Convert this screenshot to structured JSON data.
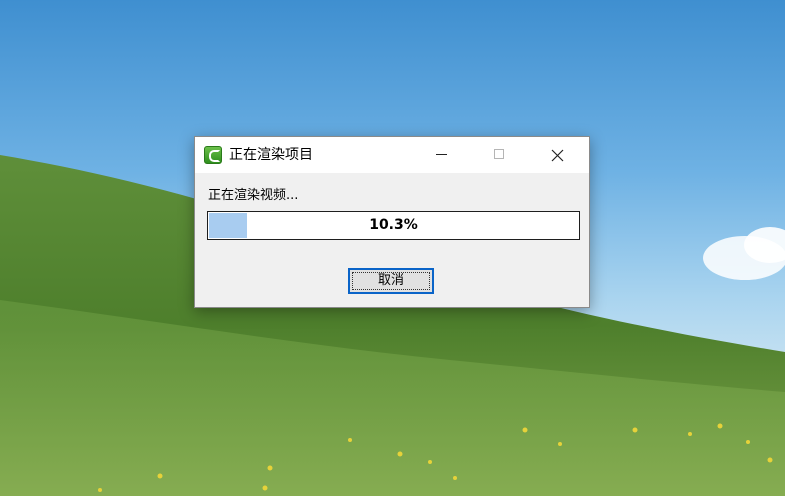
{
  "dialog": {
    "title": "正在渲染项目",
    "app_icon": "camtasia-green-c-icon",
    "window_buttons": [
      "minimize-icon",
      "maximize-icon",
      "close-icon"
    ],
    "status_text": "正在渲染视频...",
    "progress": {
      "fraction": 0.103,
      "label": "10.3%"
    },
    "cancel_label": "取消"
  },
  "colors": {
    "progress_fill": "#a8ccf0",
    "button_focus_border": "#0a64c8",
    "dialog_bg": "#f0f0f0",
    "titlebar_bg": "#ffffff"
  }
}
